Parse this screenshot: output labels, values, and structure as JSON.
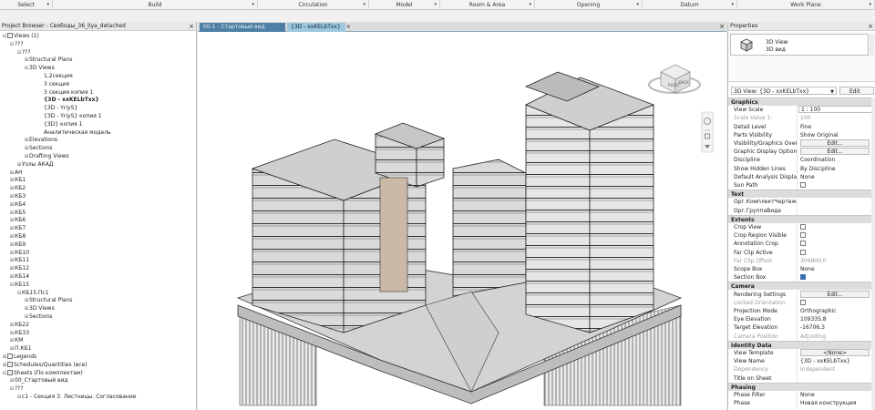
{
  "ribbon": {
    "groups": [
      "Select",
      "Build",
      "Circulation",
      "Model",
      "Room & Area",
      "Opening",
      "Datum",
      "Work Plane"
    ]
  },
  "project_browser": {
    "title": "Project Browser - Свободы_36_Ilya_detached",
    "nodes": [
      {
        "label": "Views (1)",
        "level": 0,
        "toggle": "−",
        "icon": true
      },
      {
        "label": "???",
        "level": 1,
        "toggle": "−"
      },
      {
        "label": "???",
        "level": 2,
        "toggle": "−"
      },
      {
        "label": "Structural Plans",
        "level": 3,
        "toggle": "+"
      },
      {
        "label": "3D Views",
        "level": 3,
        "toggle": "−"
      },
      {
        "label": "1,2секция",
        "level": 5,
        "toggle": ""
      },
      {
        "label": "3 секция",
        "level": 5,
        "toggle": ""
      },
      {
        "label": "3 секция копия 1",
        "level": 5,
        "toggle": ""
      },
      {
        "label": "{3D - xxKELbTxx}",
        "level": 5,
        "toggle": "",
        "bold": true
      },
      {
        "label": "{3D - YriyS}",
        "level": 5,
        "toggle": ""
      },
      {
        "label": "{3D - YriyS} копия 1",
        "level": 5,
        "toggle": ""
      },
      {
        "label": "{3D} копия 1",
        "level": 5,
        "toggle": ""
      },
      {
        "label": "Аналитическая модель",
        "level": 5,
        "toggle": ""
      },
      {
        "label": "Elevations",
        "level": 3,
        "toggle": "+"
      },
      {
        "label": "Sections",
        "level": 3,
        "toggle": "+"
      },
      {
        "label": "Drafting Views",
        "level": 3,
        "toggle": "+"
      },
      {
        "label": "Узлы АКАД",
        "level": 2,
        "toggle": "+"
      },
      {
        "label": "АН",
        "level": 1,
        "toggle": "+"
      },
      {
        "label": "КБ1",
        "level": 1,
        "toggle": "+"
      },
      {
        "label": "КБ2",
        "level": 1,
        "toggle": "+"
      },
      {
        "label": "КБ3",
        "level": 1,
        "toggle": "+"
      },
      {
        "label": "КБ4",
        "level": 1,
        "toggle": "+"
      },
      {
        "label": "КБ5",
        "level": 1,
        "toggle": "+"
      },
      {
        "label": "КБ6",
        "level": 1,
        "toggle": "+"
      },
      {
        "label": "КБ7",
        "level": 1,
        "toggle": "+"
      },
      {
        "label": "КБ8",
        "level": 1,
        "toggle": "+"
      },
      {
        "label": "КБ9",
        "level": 1,
        "toggle": "+"
      },
      {
        "label": "КБ10",
        "level": 1,
        "toggle": "+"
      },
      {
        "label": "КБ11",
        "level": 1,
        "toggle": "+"
      },
      {
        "label": "КБ12",
        "level": 1,
        "toggle": "+"
      },
      {
        "label": "КБ14",
        "level": 1,
        "toggle": "+"
      },
      {
        "label": "КБ15",
        "level": 1,
        "toggle": "−"
      },
      {
        "label": "КБ15.Пс1",
        "level": 2,
        "toggle": "−"
      },
      {
        "label": "Structural Plans",
        "level": 3,
        "toggle": "+"
      },
      {
        "label": "3D Views",
        "level": 3,
        "toggle": "+"
      },
      {
        "label": "Sections",
        "level": 3,
        "toggle": "+"
      },
      {
        "label": "КБ22",
        "level": 1,
        "toggle": "+"
      },
      {
        "label": "КБ33",
        "level": 1,
        "toggle": "+"
      },
      {
        "label": "КМ",
        "level": 1,
        "toggle": "+"
      },
      {
        "label": "П.КБ1",
        "level": 1,
        "toggle": "+"
      },
      {
        "label": "Legends",
        "level": 0,
        "toggle": "+",
        "icon": true
      },
      {
        "label": "Schedules/Quantities (все)",
        "level": 0,
        "toggle": "+",
        "icon": true
      },
      {
        "label": "Sheets (По комплектам)",
        "level": 0,
        "toggle": "−",
        "icon": true
      },
      {
        "label": "00_Стартовый вид",
        "level": 1,
        "toggle": "+"
      },
      {
        "label": "???",
        "level": 1,
        "toggle": "−"
      },
      {
        "label": "с1 - Секция 3. Лестницы. Согласование",
        "level": 2,
        "toggle": "−"
      }
    ]
  },
  "view_tabs": [
    {
      "label": "00-1 - Стартовый вид",
      "active": false
    },
    {
      "label": "{3D - xxKELbTxx}",
      "active": true
    }
  ],
  "viewcube": {
    "face_right": "RIGHT",
    "face_back": "BACK"
  },
  "properties": {
    "title": "Properties",
    "type_name": "3D View",
    "type_sub": "3D вид",
    "instance_selector": "3D View: {3D - xxKELbTxx}",
    "edit_type": "Edit Type",
    "rows": [
      {
        "kind": "hdr",
        "name": "Graphics"
      },
      {
        "kind": "val",
        "name": "View Scale",
        "value": "1 : 100",
        "boxed": true
      },
      {
        "kind": "val",
        "name": "Scale Value    1:",
        "value": "100",
        "dim": true
      },
      {
        "kind": "val",
        "name": "Detail Level",
        "value": "Fine"
      },
      {
        "kind": "val",
        "name": "Parts Visibility",
        "value": "Show Original"
      },
      {
        "kind": "btn",
        "name": "Visibility/Graphics Overri...",
        "value": "Edit..."
      },
      {
        "kind": "btn",
        "name": "Graphic Display Options",
        "value": "Edit..."
      },
      {
        "kind": "val",
        "name": "Discipline",
        "value": "Coordination"
      },
      {
        "kind": "val",
        "name": "Show Hidden Lines",
        "value": "By Discipline"
      },
      {
        "kind": "val",
        "name": "Default Analysis Display S...",
        "value": "None"
      },
      {
        "kind": "chk",
        "name": "Sun Path",
        "checked": false
      },
      {
        "kind": "hdr",
        "name": "Text"
      },
      {
        "kind": "val",
        "name": "Орг.КомплектЧертежей",
        "value": ""
      },
      {
        "kind": "val",
        "name": "Орг.ГруппаВида",
        "value": ""
      },
      {
        "kind": "hdr",
        "name": "Extents"
      },
      {
        "kind": "chk",
        "name": "Crop View",
        "checked": false
      },
      {
        "kind": "chk",
        "name": "Crop Region Visible",
        "checked": false
      },
      {
        "kind": "chk",
        "name": "Annotation Crop",
        "checked": false
      },
      {
        "kind": "chk",
        "name": "Far Clip Active",
        "checked": false
      },
      {
        "kind": "val",
        "name": "Far Clip Offset",
        "value": "304800,0",
        "dim": true
      },
      {
        "kind": "val",
        "name": "Scope Box",
        "value": "None"
      },
      {
        "kind": "chk",
        "name": "Section Box",
        "checked": true
      },
      {
        "kind": "hdr",
        "name": "Camera"
      },
      {
        "kind": "btn",
        "name": "Rendering Settings",
        "value": "Edit..."
      },
      {
        "kind": "chk",
        "name": "Locked Orientation",
        "checked": false,
        "dim": true
      },
      {
        "kind": "val",
        "name": "Projection Mode",
        "value": "Orthographic"
      },
      {
        "kind": "val",
        "name": "Eye Elevation",
        "value": "109335,8"
      },
      {
        "kind": "val",
        "name": "Target Elevation",
        "value": "-16706,3"
      },
      {
        "kind": "val",
        "name": "Camera Position",
        "value": "Adjusting",
        "dim": true
      },
      {
        "kind": "hdr",
        "name": "Identity Data"
      },
      {
        "kind": "btn",
        "name": "View Template",
        "value": "<None>"
      },
      {
        "kind": "val",
        "name": "View Name",
        "value": "{3D - xxKELbTxx}"
      },
      {
        "kind": "val",
        "name": "Dependency",
        "value": "Independent",
        "dim": true
      },
      {
        "kind": "val",
        "name": "Title on Sheet",
        "value": ""
      },
      {
        "kind": "hdr",
        "name": "Phasing"
      },
      {
        "kind": "val",
        "name": "Phase Filter",
        "value": "None"
      },
      {
        "kind": "val",
        "name": "Phase",
        "value": "Новая конструкция"
      }
    ]
  },
  "colors": {
    "tab_inactive": "#4e7fa4",
    "tab_active": "#9cc7df",
    "model_fill": "#c8c8c8",
    "model_edge": "#3a3a3a"
  }
}
